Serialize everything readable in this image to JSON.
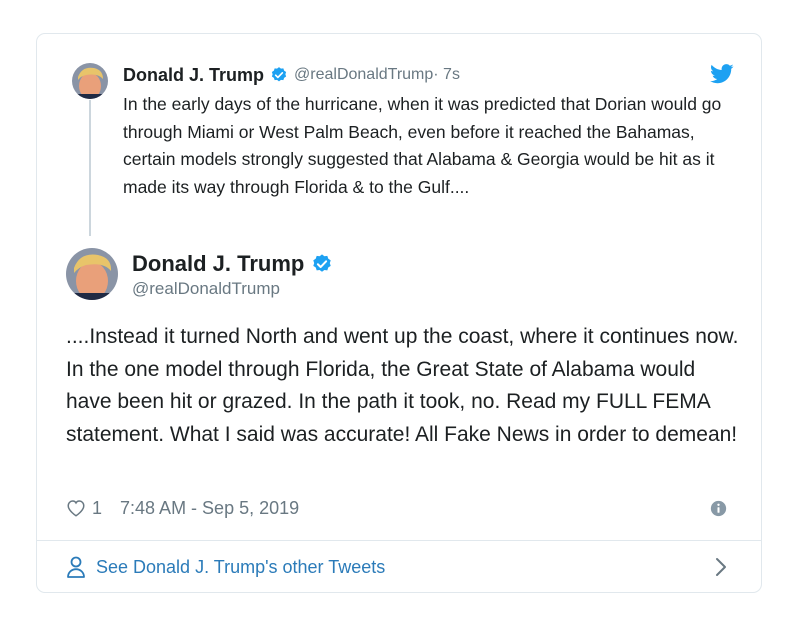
{
  "parent_tweet": {
    "name": "Donald J. Trump",
    "handle": "@realDonaldTrump",
    "time": " · 7s",
    "text": "In the early days of the hurricane, when it was predicted that Dorian would go through Miami or West Palm Beach, even before it reached the Bahamas, certain models strongly suggested that Alabama & Georgia would be hit as it made its way through Florida & to the Gulf...."
  },
  "main_tweet": {
    "name": "Donald J. Trump",
    "handle": "@realDonaldTrump",
    "text": "....Instead it turned North and went up the coast, where it continues now. In the one model through Florida, the Great State of Alabama would have been hit or grazed. In the path it took, no. Read my FULL FEMA statement. What I said was accurate! All Fake News in order to demean!",
    "likes": "1",
    "timestamp": "7:48 AM - Sep 5, 2019"
  },
  "footer": {
    "link_label": "See Donald J. Trump's other Tweets"
  },
  "icons": {
    "verified": "verified-badge-icon",
    "twitter": "twitter-bird-icon",
    "like": "heart-icon",
    "info": "info-icon",
    "profile": "person-icon",
    "more": "chevron-right-icon"
  },
  "colors": {
    "verified": "#1da1f2",
    "twitter_bird": "#1da1f2",
    "link": "#2b7bb9",
    "secondary_text": "#697882",
    "border": "#e1e8ed"
  }
}
